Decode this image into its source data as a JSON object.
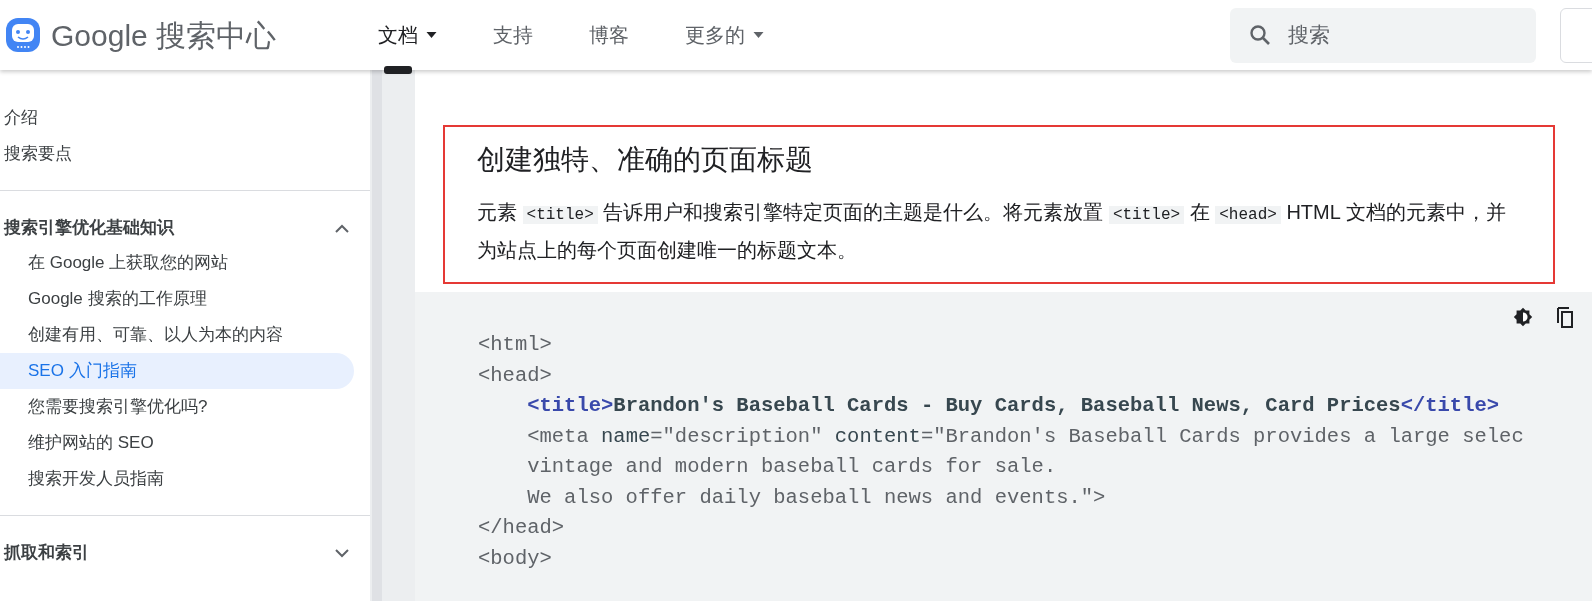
{
  "header": {
    "brand": "Google 搜索中心",
    "nav": [
      {
        "label": "文档",
        "selected": true,
        "dropdown": true
      },
      {
        "label": "支持",
        "selected": false,
        "dropdown": false
      },
      {
        "label": "博客",
        "selected": false,
        "dropdown": false
      },
      {
        "label": "更多的",
        "selected": false,
        "dropdown": true
      }
    ],
    "search": {
      "placeholder": "搜索"
    }
  },
  "sidebar": {
    "groups": [
      {
        "kind": "plain",
        "items": [
          {
            "label": "介绍",
            "selected": false
          },
          {
            "label": "搜索要点",
            "selected": false
          }
        ]
      },
      {
        "kind": "section",
        "title": "搜索引擎优化基础知识",
        "expanded": true,
        "items": [
          {
            "label": "在 Google 上获取您的网站",
            "selected": false
          },
          {
            "label": "Google 搜索的工作原理",
            "selected": false
          },
          {
            "label": "创建有用、可靠、以人为本的内容",
            "selected": false
          },
          {
            "label": "SEO 入门指南",
            "selected": true
          },
          {
            "label": "您需要搜索引擎优化吗?",
            "selected": false
          },
          {
            "label": "维护网站的 SEO",
            "selected": false
          },
          {
            "label": "搜索开发人员指南",
            "selected": false
          }
        ]
      },
      {
        "kind": "section",
        "title": "抓取和索引",
        "expanded": false
      }
    ]
  },
  "article": {
    "heading": "创建独特、准确的页面标题",
    "paragraph": [
      {
        "kind": "text",
        "text": "元素 "
      },
      {
        "kind": "code",
        "text": "<title>"
      },
      {
        "kind": "text",
        "text": " 告诉用户和搜索引擎特定页面的主题是什么。将元素放置 "
      },
      {
        "kind": "code",
        "text": "<title>"
      },
      {
        "kind": "text",
        "text": " 在 "
      },
      {
        "kind": "code",
        "text": "<head>"
      },
      {
        "kind": "text",
        "text": " HTML 文档的元素中，并为站点上的每个页面创建唯一的标题文本。"
      }
    ],
    "code_lines": [
      [
        {
          "kind": "plain",
          "text": "<html>"
        }
      ],
      [
        {
          "kind": "plain",
          "text": "<head>"
        }
      ],
      [
        {
          "kind": "tag",
          "text": "    <title>"
        },
        {
          "kind": "bold",
          "text": "Brandon's Baseball Cards - Buy Cards, Baseball News, Card Prices"
        },
        {
          "kind": "tag",
          "text": "</title>"
        }
      ],
      [
        {
          "kind": "plain",
          "text": "    <meta "
        },
        {
          "kind": "attr",
          "text": "name"
        },
        {
          "kind": "plain",
          "text": "=\"description\" "
        },
        {
          "kind": "attr",
          "text": "content"
        },
        {
          "kind": "plain",
          "text": "=\"Brandon's Baseball Cards provides a large selec"
        }
      ],
      [
        {
          "kind": "plain",
          "text": "    vintage and modern baseball cards for sale."
        }
      ],
      [
        {
          "kind": "plain",
          "text": "    We also offer daily baseball news and events.\">"
        }
      ],
      [
        {
          "kind": "plain",
          "text": "</head>"
        }
      ],
      [
        {
          "kind": "plain",
          "text": "<body>"
        }
      ]
    ]
  }
}
